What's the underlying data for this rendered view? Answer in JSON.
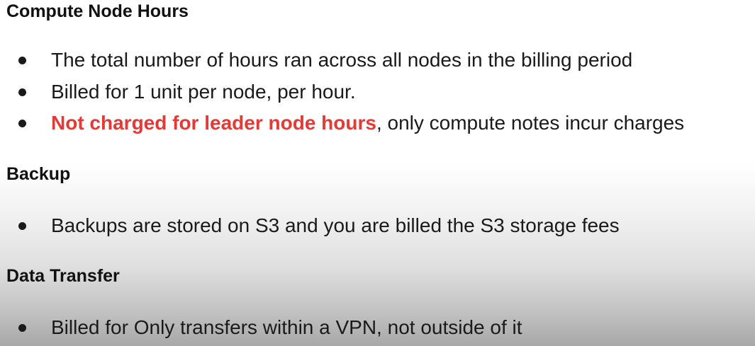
{
  "sections": [
    {
      "heading": "Compute Node Hours",
      "bullets": [
        {
          "text": "The total number of hours ran across all nodes in the billing period"
        },
        {
          "text": "Billed for 1 unit per node, per hour."
        },
        {
          "highlight": "Not charged for leader node hours",
          "text": ", only compute notes incur charges"
        }
      ]
    },
    {
      "heading": "Backup",
      "bullets": [
        {
          "text": "Backups are stored on S3 and you are billed the S3 storage fees"
        }
      ]
    },
    {
      "heading": "Data Transfer",
      "bullets": [
        {
          "text": "Billed for Only transfers within a VPN, not outside of it"
        }
      ]
    }
  ],
  "colors": {
    "highlight": "#e53935",
    "text": "#1a1a1a"
  }
}
